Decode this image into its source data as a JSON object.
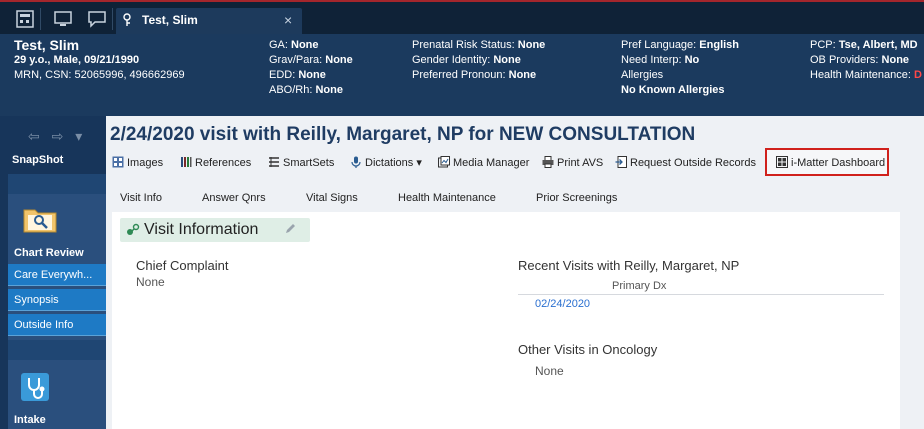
{
  "tab": {
    "title": "Test, Slim",
    "close": "×"
  },
  "patient": {
    "name": "Test, Slim",
    "age_line": "29 y.o., Male, 09/21/1990",
    "mrn_line": "MRN, CSN: 52065996, 496662969"
  },
  "header": {
    "ga_label": "GA:",
    "ga_value": "None",
    "gravpara_label": "Grav/Para:",
    "gravpara_value": "None",
    "edd_label": "EDD:",
    "edd_value": "None",
    "aborh_label": "ABO/Rh:",
    "aborh_value": "None",
    "prenatal_label": "Prenatal Risk Status:",
    "prenatal_value": "None",
    "gender_label": "Gender Identity:",
    "gender_value": "None",
    "pronoun_label": "Preferred Pronoun:",
    "pronoun_value": "None",
    "lang_label": "Pref Language:",
    "lang_value": "English",
    "interp_label": "Need Interp:",
    "interp_value": "No",
    "allergies_label": "Allergies",
    "allergies_value": "No Known Allergies",
    "pcp_label": "PCP:",
    "pcp_value": "Tse, Albert, MD",
    "ob_label": "OB Providers:",
    "ob_value": "None",
    "hm_label": "Health Maintenance:",
    "hm_value": "D"
  },
  "sidebar": {
    "nav_arrows": "⇦ ⇨ ▾",
    "snapshot": "SnapShot",
    "chart_review": "Chart Review",
    "items": [
      "Care Everywh...",
      "Synopsis",
      "Outside Info"
    ],
    "intake": "Intake"
  },
  "visit": {
    "title": "2/24/2020 visit with Reilly, Margaret, NP for NEW CONSULTATION"
  },
  "toolbar": {
    "images": "Images",
    "references": "References",
    "smartsets": "SmartSets",
    "dictations": "Dictations",
    "media_manager": "Media Manager",
    "print_avs": "Print AVS",
    "request_outside": "Request Outside Records",
    "imatter": "i-Matter Dashboard"
  },
  "subtabs": [
    "Visit Info",
    "Answer Qnrs",
    "Vital Signs",
    "Health Maintenance",
    "Prior Screenings"
  ],
  "visit_info": {
    "title": "Visit Information",
    "chief_complaint_label": "Chief Complaint",
    "chief_complaint_value": "None",
    "recent_visits_label": "Recent Visits with Reilly, Margaret, NP",
    "primary_dx_label": "Primary Dx",
    "recent_date": "02/24/2020",
    "other_visits_label": "Other Visits in Oncology",
    "other_visits_value": "None"
  },
  "colors": {
    "highlight_box": "#d0211c",
    "header_bg": "#1b3a5e",
    "link": "#2a6fd0"
  }
}
